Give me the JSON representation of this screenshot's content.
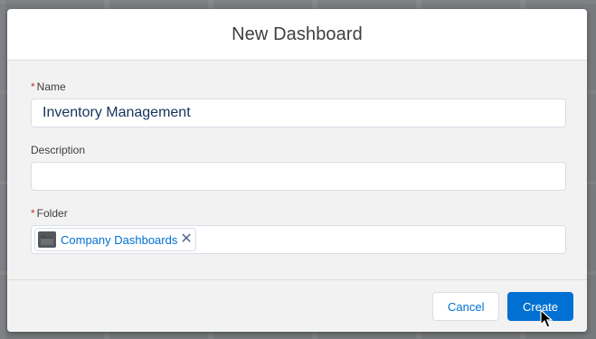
{
  "modal": {
    "title": "New Dashboard"
  },
  "form": {
    "name": {
      "required_marker": "*",
      "label": "Name",
      "value": "Inventory Management"
    },
    "description": {
      "label": "Description",
      "value": ""
    },
    "folder": {
      "required_marker": "*",
      "label": "Folder",
      "selected_pill": {
        "icon": "folder-icon",
        "label": "Company Dashboards",
        "remove_icon": "close-icon",
        "remove_glyph": "✕"
      }
    }
  },
  "footer": {
    "cancel_label": "Cancel",
    "create_label": "Create"
  },
  "colors": {
    "brand": "#0070d2",
    "required": "#c23934",
    "text": "#16325c"
  }
}
